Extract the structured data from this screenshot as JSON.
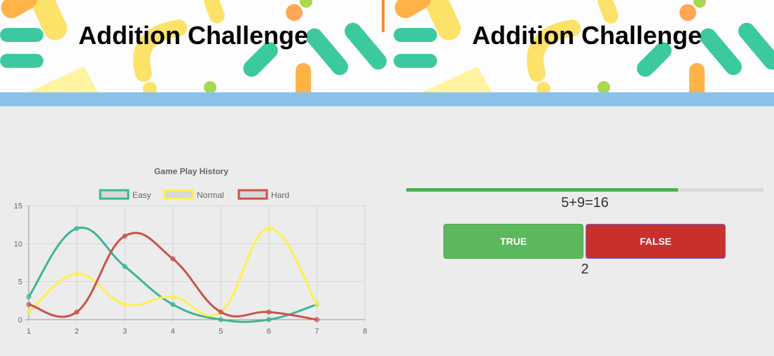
{
  "banner": {
    "title_left": "Addition Challenge",
    "title_right": "Addition Challenge"
  },
  "game": {
    "question": "5+9=16",
    "true_label": "TRUE",
    "false_label": "FALSE",
    "score": "2",
    "progress_fraction": 0.76
  },
  "colors": {
    "banner_bar": "#89c1e9",
    "progress": "#4caf50",
    "true_button": "#5cb85c",
    "false_button": "#c9302c"
  },
  "chart_data": {
    "type": "line",
    "title": "Game Play History",
    "x": [
      1,
      2,
      3,
      4,
      5,
      6,
      7
    ],
    "x_ticks": [
      "1",
      "2",
      "3",
      "4",
      "5",
      "6",
      "7",
      "8"
    ],
    "y_ticks": [
      "0",
      "5",
      "10",
      "15"
    ],
    "xlim": [
      1,
      8
    ],
    "ylim": [
      0,
      15
    ],
    "grid": true,
    "legend": "top",
    "series": [
      {
        "name": "Easy",
        "color": "#3cb497",
        "values": [
          3,
          12,
          7,
          2,
          0,
          0,
          2
        ]
      },
      {
        "name": "Normal",
        "color": "#fff04d",
        "values": [
          1,
          6,
          2,
          3,
          1,
          12,
          2
        ]
      },
      {
        "name": "Hard",
        "color": "#c8534a",
        "values": [
          2,
          1,
          11,
          8,
          1,
          1,
          0
        ]
      }
    ]
  }
}
